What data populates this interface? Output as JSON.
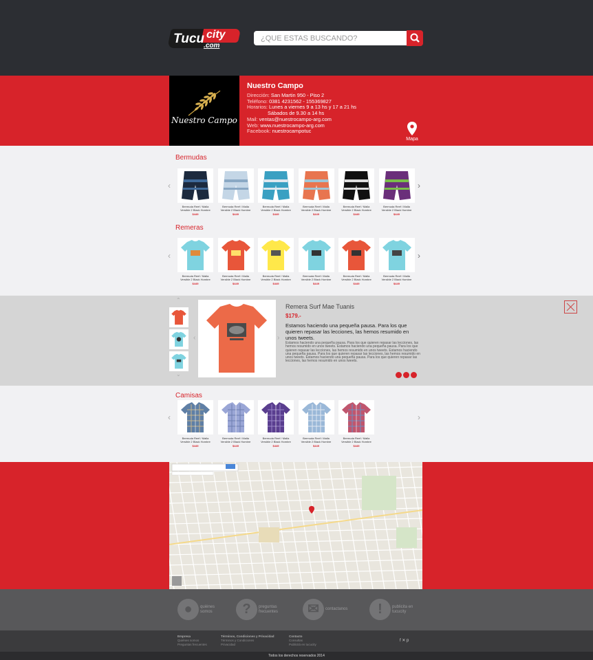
{
  "header": {
    "logo_main": "Tucu",
    "logo_city": "city",
    "logo_com": ".com",
    "search_placeholder": "¿QUE ESTAS BUSCANDO?"
  },
  "store": {
    "logo_text": "Nuestro Campo",
    "name": "Nuestro Campo",
    "address_label": "Dirección:",
    "address": "San Martin 950 - Piso 2",
    "phone_label": "Teléfono:",
    "phone": "0381 4231562 - 155369827",
    "hours_label": "Horarios:",
    "hours1": "Lunes a viernes 9 a 13 hs y 17 a 21 hs",
    "hours2": "Sábados de 9.30 a 14 hs",
    "mail_label": "Mail:",
    "mail": "ventas@nuestrocampo-arg.com",
    "web_label": "Web:",
    "web": "www.nuestrocampo-arg.com",
    "facebook_label": "Facebook:",
    "facebook": "nuestrocampotuc",
    "map_label": "Mapa"
  },
  "sections": {
    "bermudas": {
      "title": "Bermudas",
      "items": [
        {
          "cap1": "Bermuda Reef / Malla",
          "cap2": "Versible 2 Black Hombre",
          "price": "$449"
        },
        {
          "cap1": "Bermuda Reef / Malla",
          "cap2": "Versible 2 Black Hombre",
          "price": "$449"
        },
        {
          "cap1": "Bermuda Reef / Malla",
          "cap2": "Versible 2 Black Hombre",
          "price": "$449"
        },
        {
          "cap1": "Bermuda Reef / Malla",
          "cap2": "Versible 2 Black Hombre",
          "price": "$449"
        },
        {
          "cap1": "Bermuda Reef / Malla",
          "cap2": "Versible 2 Black Hombre",
          "price": "$449"
        },
        {
          "cap1": "Bermuda Reef / Malla",
          "cap2": "Versible 2 Black Hombre",
          "price": "$449"
        }
      ]
    },
    "remeras": {
      "title": "Remeras",
      "items": [
        {
          "cap1": "Bermuda Reef / Malla",
          "cap2": "Versible 2 Black Hombre",
          "price": "$449"
        },
        {
          "cap1": "Bermuda Reef / Malla",
          "cap2": "Versible 2 Black Hombre",
          "price": "$449"
        },
        {
          "cap1": "Bermuda Reef / Malla",
          "cap2": "Versible 2 Black Hombre",
          "price": "$449"
        },
        {
          "cap1": "Bermuda Reef / Malla",
          "cap2": "Versible 2 Black Hombre",
          "price": "$449"
        },
        {
          "cap1": "Bermuda Reef / Malla",
          "cap2": "Versible 2 Black Hombre",
          "price": "$449"
        },
        {
          "cap1": "Bermuda Reef / Malla",
          "cap2": "Versible 2 Black Hombre",
          "price": "$449"
        }
      ]
    },
    "camisas": {
      "title": "Camisas",
      "items": [
        {
          "cap1": "Bermuda Reef / Malla",
          "cap2": "Versible 2 Black Hombre",
          "price": "$449"
        },
        {
          "cap1": "Bermuda Reef / Malla",
          "cap2": "Versible 2 Black Hombre",
          "price": "$449"
        },
        {
          "cap1": "Bermuda Reef / Malla",
          "cap2": "Versible 2 Black Hombre",
          "price": "$449"
        },
        {
          "cap1": "Bermuda Reef / Malla",
          "cap2": "Versible 2 Black Hombre",
          "price": "$449"
        },
        {
          "cap1": "Bermuda Reef / Malla",
          "cap2": "Versible 2 Black Hombre",
          "price": "$449"
        }
      ]
    }
  },
  "detail": {
    "title": "Remera Surf Mae Tuanis",
    "price": "$179.-",
    "lead": "Estamos haciendo una pequeña pausa. Para los que quieren repasar las lecciones, las hemos resumido en unos tweets.",
    "body": "Estamos haciendo una pequeña pausa. Para los que quieren repasar las lecciones, las hemos resumido en unos tweets. Estamos haciendo una pequeña pausa. Para los que quieren repasar las lecciones, las hemos resumido en unos tweets. Estamos haciendo una pequeña pausa. Para los que quieren repasar las lecciones, las hemos resumido en unos tweets. Estamos haciendo una pequeña pausa. Para los que quieren repasar las lecciones, las hemos resumido en unos tweets."
  },
  "footer": {
    "links": [
      {
        "l1": "quiénes",
        "l2": "somos",
        "glyph": "●"
      },
      {
        "l1": "preguntas",
        "l2": "frecuentes",
        "glyph": "?"
      },
      {
        "l1": "contactanos",
        "l2": "",
        "glyph": "✉"
      },
      {
        "l1": "publicita en",
        "l2": "tucucity",
        "glyph": "!"
      }
    ],
    "col1_title": "Empresa",
    "col1_a": "Quiénes somos",
    "col1_b": "Preguntas frecuentes",
    "col2_title": "Términos, Condiciones y Privacidad",
    "col2_a": "Términos y Condiciones",
    "col2_b": "Privacidad",
    "col3_title": "Contacto",
    "col3_a": "Consultas",
    "col3_b": "Publicitá en tucucity",
    "copyright": "Todos los derechos reservados 2014"
  }
}
